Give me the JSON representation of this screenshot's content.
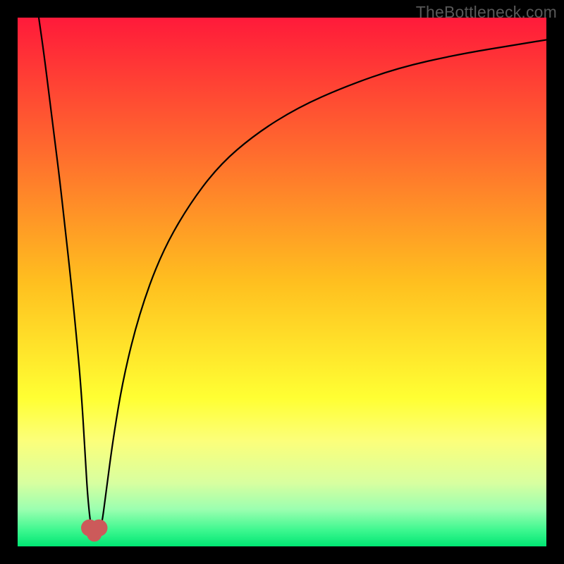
{
  "watermark": "TheBottleneck.com",
  "chart_data": {
    "type": "line",
    "title": "",
    "xlabel": "",
    "ylabel": "",
    "xlim": [
      0,
      100
    ],
    "ylim": [
      0,
      100
    ],
    "grid": false,
    "legend": false,
    "gradient_stops": [
      {
        "offset": 0.0,
        "color": "#ff1a3a"
      },
      {
        "offset": 0.25,
        "color": "#ff6a2e"
      },
      {
        "offset": 0.5,
        "color": "#ffbf1f"
      },
      {
        "offset": 0.72,
        "color": "#ffff33"
      },
      {
        "offset": 0.8,
        "color": "#fcff7a"
      },
      {
        "offset": 0.88,
        "color": "#d8ffa0"
      },
      {
        "offset": 0.93,
        "color": "#9bffb0"
      },
      {
        "offset": 0.97,
        "color": "#3cf78f"
      },
      {
        "offset": 1.0,
        "color": "#00e673"
      }
    ],
    "series": [
      {
        "name": "bottleneck-curve",
        "color": "#000000",
        "width": 2.2,
        "x": [
          4,
          5,
          6,
          7,
          8,
          9,
          10,
          11,
          12,
          12.8,
          13.2,
          13.8,
          14.3,
          14.8,
          15.3,
          15.9,
          16.7,
          18,
          20,
          23,
          27,
          32,
          38,
          45,
          53,
          62,
          72,
          83,
          95,
          100
        ],
        "y": [
          100,
          93,
          85,
          77,
          69,
          60,
          51,
          41,
          30,
          17,
          10,
          4,
          2.2,
          2.0,
          2.2,
          4,
          10,
          20,
          32,
          44,
          55,
          64,
          72,
          78,
          83,
          87,
          90.5,
          93,
          95,
          95.8
        ]
      }
    ],
    "markers": [
      {
        "name": "min-left",
        "x": 13.6,
        "y": 3.5,
        "r": 1.6,
        "color": "#cc5a5a"
      },
      {
        "name": "min-right",
        "x": 15.4,
        "y": 3.5,
        "r": 1.6,
        "color": "#cc5a5a"
      },
      {
        "name": "min-mid",
        "x": 14.5,
        "y": 2.3,
        "r": 1.4,
        "color": "#cc5a5a"
      }
    ]
  }
}
